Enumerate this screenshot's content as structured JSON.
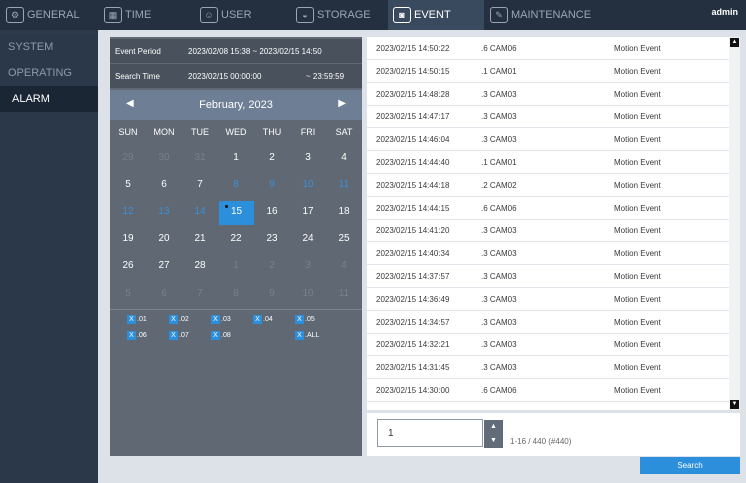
{
  "topnav": {
    "tabs": [
      {
        "label": "GENERAL",
        "icon": "gear-icon"
      },
      {
        "label": "TIME",
        "icon": "calendar-icon"
      },
      {
        "label": "USER",
        "icon": "user-icon"
      },
      {
        "label": "STORAGE",
        "icon": "storage-icon"
      },
      {
        "label": "EVENT",
        "icon": "camera-event-icon",
        "active": true
      },
      {
        "label": "MAINTENANCE",
        "icon": "maintenance-icon"
      }
    ],
    "user": "admin"
  },
  "sidebar": {
    "items": [
      {
        "label": "SYSTEM"
      },
      {
        "label": "OPERATING"
      },
      {
        "label": "ALARM",
        "active": true
      }
    ]
  },
  "filter": {
    "event_period_label": "Event Period",
    "event_period_value": "2023/02/08 15:38 ~ 2023/02/15 14:50",
    "search_time_label": "Search Time",
    "search_time_start": "2023/02/15 00:00:00",
    "search_time_end": "~ 23:59:59"
  },
  "calendar": {
    "month_title": "February, 2023",
    "prev_icon": "chevron-left-icon",
    "next_icon": "chevron-right-icon",
    "weekdays": [
      "SUN",
      "MON",
      "TUE",
      "WED",
      "THU",
      "FRI",
      "SAT"
    ],
    "weeks": [
      [
        {
          "d": "29",
          "o": true
        },
        {
          "d": "30",
          "o": true
        },
        {
          "d": "31",
          "o": true
        },
        {
          "d": "1"
        },
        {
          "d": "2"
        },
        {
          "d": "3"
        },
        {
          "d": "4"
        }
      ],
      [
        {
          "d": "5"
        },
        {
          "d": "6"
        },
        {
          "d": "7"
        },
        {
          "d": "8",
          "b": true
        },
        {
          "d": "9",
          "b": true
        },
        {
          "d": "10",
          "b": true
        },
        {
          "d": "11",
          "b": true
        }
      ],
      [
        {
          "d": "12",
          "b": true
        },
        {
          "d": "13",
          "b": true
        },
        {
          "d": "14",
          "b": true
        },
        {
          "d": "15",
          "s": true
        },
        {
          "d": "16"
        },
        {
          "d": "17"
        },
        {
          "d": "18"
        }
      ],
      [
        {
          "d": "19"
        },
        {
          "d": "20"
        },
        {
          "d": "21"
        },
        {
          "d": "22"
        },
        {
          "d": "23"
        },
        {
          "d": "24"
        },
        {
          "d": "25"
        }
      ],
      [
        {
          "d": "26"
        },
        {
          "d": "27"
        },
        {
          "d": "28"
        },
        {
          "d": "1",
          "o": true
        },
        {
          "d": "2",
          "o": true
        },
        {
          "d": "3",
          "o": true
        },
        {
          "d": "4",
          "o": true
        }
      ],
      [
        {
          "d": "5",
          "o": true
        },
        {
          "d": "6",
          "o": true
        },
        {
          "d": "7",
          "o": true
        },
        {
          "d": "8",
          "o": true
        },
        {
          "d": "9",
          "o": true
        },
        {
          "d": "10",
          "o": true
        },
        {
          "d": "11",
          "o": true
        }
      ]
    ]
  },
  "cameras": [
    {
      "mark": "X",
      "label": ".01"
    },
    {
      "mark": "X",
      "label": ".02"
    },
    {
      "mark": "X",
      "label": ".03"
    },
    {
      "mark": "X",
      "label": ".04"
    },
    {
      "mark": "X",
      "label": ".05"
    },
    {
      "mark": "X",
      "label": ".06"
    },
    {
      "mark": "X",
      "label": ".07"
    },
    {
      "mark": "X",
      "label": ".08"
    },
    {
      "mark": "X",
      "label": ".ALL"
    }
  ],
  "events": [
    {
      "time": "2023/02/15 14:50:22",
      "camera": ".6 CAM06",
      "type": "Motion Event"
    },
    {
      "time": "2023/02/15 14:50:15",
      "camera": ".1 CAM01",
      "type": "Motion Event"
    },
    {
      "time": "2023/02/15 14:48:28",
      "camera": ".3 CAM03",
      "type": "Motion Event"
    },
    {
      "time": "2023/02/15 14:47:17",
      "camera": ".3 CAM03",
      "type": "Motion Event"
    },
    {
      "time": "2023/02/15 14:46:04",
      "camera": ".3 CAM03",
      "type": "Motion Event"
    },
    {
      "time": "2023/02/15 14:44:40",
      "camera": ".1 CAM01",
      "type": "Motion Event"
    },
    {
      "time": "2023/02/15 14:44:18",
      "camera": ".2 CAM02",
      "type": "Motion Event"
    },
    {
      "time": "2023/02/15 14:44:15",
      "camera": ".6 CAM06",
      "type": "Motion Event"
    },
    {
      "time": "2023/02/15 14:41:20",
      "camera": ".3 CAM03",
      "type": "Motion Event"
    },
    {
      "time": "2023/02/15 14:40:34",
      "camera": ".3 CAM03",
      "type": "Motion Event"
    },
    {
      "time": "2023/02/15 14:37:57",
      "camera": ".3 CAM03",
      "type": "Motion Event"
    },
    {
      "time": "2023/02/15 14:36:49",
      "camera": ".3 CAM03",
      "type": "Motion Event"
    },
    {
      "time": "2023/02/15 14:34:57",
      "camera": ".3 CAM03",
      "type": "Motion Event"
    },
    {
      "time": "2023/02/15 14:32:21",
      "camera": ".3 CAM03",
      "type": "Motion Event"
    },
    {
      "time": "2023/02/15 14:31:45",
      "camera": ".3 CAM03",
      "type": "Motion Event"
    },
    {
      "time": "2023/02/15 14:30:00",
      "camera": ".6 CAM06",
      "type": "Motion Event"
    }
  ],
  "pager": {
    "page_value": "1",
    "up_icon": "▲",
    "down_icon": "▼",
    "info": "1-16 / 440 (#440)"
  },
  "list_scroll": {
    "up": "▲",
    "down": "▼"
  },
  "search_label": "Search",
  "colors": {
    "accent": "#2b8fdc",
    "navbar": "#243040",
    "sidebar": "#2a384a"
  }
}
